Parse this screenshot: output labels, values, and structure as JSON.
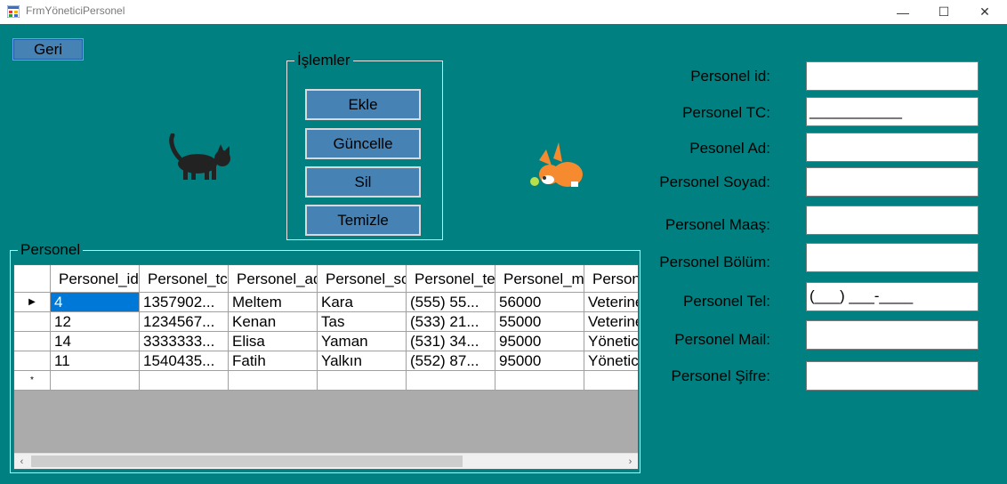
{
  "window": {
    "title": "FrmYöneticiPersonel",
    "minimize_glyph": "—",
    "maximize_glyph": "☐",
    "close_glyph": "✕"
  },
  "buttons": {
    "back": "Geri"
  },
  "operations": {
    "title": "İşlemler",
    "add": "Ekle",
    "update": "Güncelle",
    "delete": "Sil",
    "clear": "Temizle"
  },
  "personnel_group": {
    "title": "Personel"
  },
  "form": {
    "id_label": "Personel id:",
    "id_value": "",
    "tc_label": "Personel TC:",
    "tc_value": "___________",
    "ad_label": "Pesonel Ad:",
    "ad_value": "",
    "soyad_label": "Personel Soyad:",
    "soyad_value": "",
    "maas_label": "Personel Maaş:",
    "maas_value": "",
    "bolum_label": "Personel Bölüm:",
    "bolum_value": "",
    "tel_label": "Personel Tel:",
    "tel_value": "(___) ___-____",
    "mail_label": "Personel Mail:",
    "mail_value": "",
    "sifre_label": "Personel Şifre:",
    "sifre_value": ""
  },
  "grid": {
    "columns": [
      "Personel_id",
      "Personel_tc",
      "Personel_ad",
      "Personel_soyad",
      "Personel_tel",
      "Personel_maas",
      "Personel_bolum"
    ],
    "rows": [
      [
        "4",
        "1357902...",
        "Meltem",
        "Kara",
        "(555) 55...",
        "56000",
        "Veteriner"
      ],
      [
        "12",
        "1234567...",
        "Kenan",
        "Tas",
        "(533) 21...",
        "55000",
        "Veteriner"
      ],
      [
        "14",
        "3333333...",
        "Elisa",
        "Yaman",
        "(531) 34...",
        "95000",
        "Yönetici"
      ],
      [
        "11",
        "1540435...",
        "Fatih",
        "Yalkın",
        "(552) 87...",
        "95000",
        "Yönetici"
      ]
    ],
    "current_row_glyph": "▶",
    "new_row_glyph": "*",
    "scroll_left": "‹",
    "scroll_right": "›"
  },
  "colors": {
    "background": "#008080",
    "button": "#4682b4",
    "selection": "#0078d7"
  }
}
